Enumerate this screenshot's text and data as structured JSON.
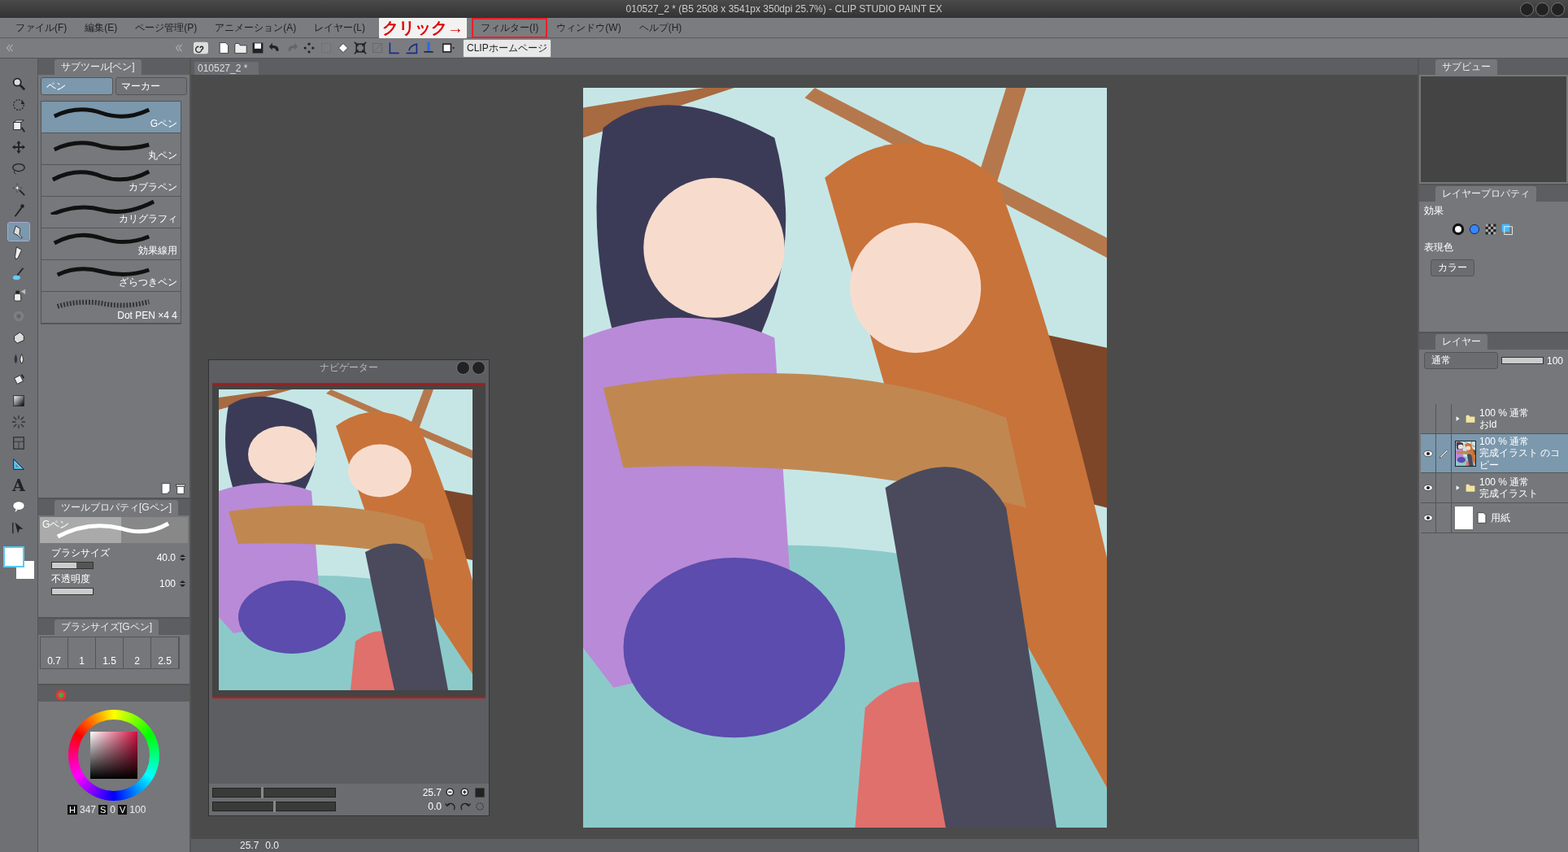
{
  "window": {
    "title": "010527_2 * (B5 2508 x 3541px 350dpi 25.7%)  - CLIP STUDIO PAINT EX"
  },
  "menu": [
    {
      "label": "ファイル(F)",
      "highlighted": false
    },
    {
      "label": "編集(E)",
      "highlighted": false
    },
    {
      "label": "ページ管理(P)",
      "highlighted": false
    },
    {
      "label": "アニメーション(A)",
      "highlighted": false
    },
    {
      "label": "レイヤー(L)",
      "highlighted": false
    },
    {
      "label": "フィルター(I)",
      "highlighted": true
    },
    {
      "label": "ウィンドウ(W)",
      "highlighted": false
    },
    {
      "label": "ヘルプ(H)",
      "highlighted": false
    }
  ],
  "annotation": {
    "text": "クリック→"
  },
  "toolbar": {
    "home_button": "CLIPホームページ"
  },
  "tools": [
    {
      "kind": "zoom",
      "selected": false
    },
    {
      "kind": "rotate",
      "selected": false
    },
    {
      "kind": "cube",
      "selected": false
    },
    {
      "kind": "move",
      "selected": false
    },
    {
      "kind": "lasso",
      "selected": false
    },
    {
      "kind": "wand",
      "selected": false
    },
    {
      "kind": "dropper",
      "selected": false
    },
    {
      "kind": "pen",
      "selected": true
    },
    {
      "kind": "pencil",
      "selected": false
    },
    {
      "kind": "brush",
      "selected": false
    },
    {
      "kind": "spray",
      "selected": false
    },
    {
      "kind": "blend",
      "selected": false
    },
    {
      "kind": "eraser",
      "selected": false
    },
    {
      "kind": "drops",
      "selected": false
    },
    {
      "kind": "bucket",
      "selected": false
    },
    {
      "kind": "gradient",
      "selected": false
    },
    {
      "kind": "burst",
      "selected": false
    },
    {
      "kind": "frame",
      "selected": false
    },
    {
      "kind": "ruler",
      "selected": false
    },
    {
      "kind": "text",
      "label": "A",
      "selected": false
    },
    {
      "kind": "balloon",
      "selected": false
    },
    {
      "kind": "arrow",
      "selected": false
    }
  ],
  "subtool_panel": {
    "title": "サブツール[ペン]",
    "groups": [
      {
        "label": "ペン",
        "selected": true
      },
      {
        "label": "マーカー",
        "selected": false
      }
    ],
    "brushes": [
      {
        "name": "Gペン",
        "selected": true
      },
      {
        "name": "丸ペン",
        "selected": false
      },
      {
        "name": "カブラペン",
        "selected": false
      },
      {
        "name": "カリグラフィ",
        "selected": false
      },
      {
        "name": "効果線用",
        "selected": false
      },
      {
        "name": "ざらつきペン",
        "selected": false
      },
      {
        "name": "Dot PEN ×4 4",
        "selected": false
      }
    ]
  },
  "tool_property": {
    "title": "ツールプロパティ[Gペン]",
    "preview_label": "Gペン",
    "rows": [
      {
        "label": "ブラシサイズ",
        "value": "40.0",
        "level": 0.6
      },
      {
        "label": "不透明度",
        "value": "100",
        "level": 1
      }
    ]
  },
  "brush_size": {
    "title": "ブラシサイズ[Gペン]",
    "presets": [
      "0.7",
      "1",
      "1.5",
      "2",
      "2.5"
    ]
  },
  "color": {
    "h_label": "H",
    "h": "347",
    "s_label": "S",
    "s": "0",
    "v_label": "V",
    "v": "100"
  },
  "canvas": {
    "tab": "010527_2 *"
  },
  "navigator": {
    "title": "ナビゲーター",
    "zoom": "25.7",
    "rotation": "0.0",
    "zoom_slider": {
      "level": 0.4
    },
    "rotation_slider": {
      "level": 0.5
    }
  },
  "status_bar": {
    "zoom": "25.7",
    "rotation": "0.0"
  },
  "subview": {
    "tab": "サブビュー"
  },
  "layer_property": {
    "tab": "レイヤープロパティ",
    "effect_label": "効果",
    "expression_label": "表現色",
    "expression_value": "カラー"
  },
  "layers_panel": {
    "tab": "レイヤー",
    "blend_mode": "通常",
    "opacity": "100",
    "opacity_slider": {
      "level": 1
    },
    "layers": [
      {
        "kind": "folder",
        "visible": false,
        "editing": false,
        "selected": false,
        "info": "100 % 通常",
        "name": "おld"
      },
      {
        "kind": "raster",
        "visible": true,
        "editing": true,
        "selected": true,
        "info": "100 % 通常",
        "name": "完成イラスト のコピー"
      },
      {
        "kind": "folder",
        "visible": true,
        "editing": false,
        "selected": false,
        "info": "100 % 通常",
        "name": "完成イラスト"
      },
      {
        "kind": "paper",
        "visible": true,
        "editing": false,
        "selected": false,
        "name": "用紙"
      }
    ]
  }
}
